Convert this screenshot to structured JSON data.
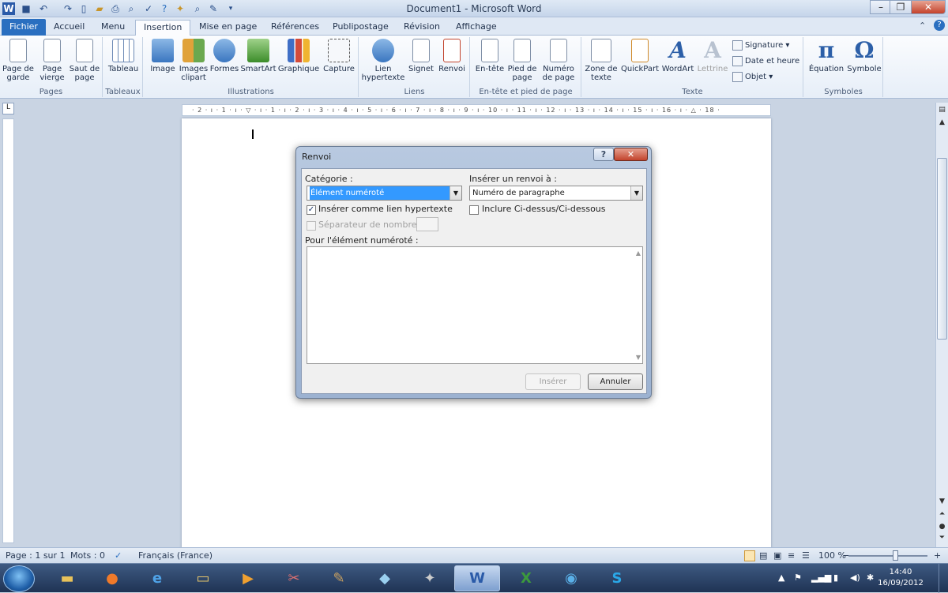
{
  "window": {
    "title": "Document1 - Microsoft Word"
  },
  "colors": {
    "accent": "#2a6fc0",
    "taskbar": "#1f3354",
    "close": "#c2432c"
  },
  "tabs": [
    "Fichier",
    "Accueil",
    "Menu",
    "Insertion",
    "Mise en page",
    "Références",
    "Publipostage",
    "Révision",
    "Affichage"
  ],
  "active_tab": "Insertion",
  "ribbon": {
    "groups": {
      "pages": "Pages",
      "tableaux": "Tableaux",
      "illustrations": "Illustrations",
      "liens": "Liens",
      "entete": "En-tête et pied de page",
      "texte": "Texte",
      "symboles": "Symboles"
    },
    "buttons": {
      "page_de_garde": "Page de garde",
      "page_vierge": "Page vierge",
      "saut_de_page": "Saut de page",
      "tableau": "Tableau",
      "image": "Image",
      "images_clipart": "Images clipart",
      "formes": "Formes",
      "smartart": "SmartArt",
      "graphique": "Graphique",
      "capture": "Capture",
      "lien_hypertexte": "Lien hypertexte",
      "signet": "Signet",
      "renvoi": "Renvoi",
      "en_tete": "En-tête",
      "pied_de_page": "Pied de page",
      "numero_de_page": "Numéro de page",
      "zone_de_texte": "Zone de texte",
      "quickpart": "QuickPart",
      "wordart": "WordArt",
      "lettrine": "Lettrine",
      "signature": "Signature",
      "date_et_heure": "Date et heure",
      "objet": "Objet",
      "equation": "Équation",
      "symbole": "Symbole"
    }
  },
  "ruler": {
    "numbers": "· 2 · ı · 1 · ı · ▽ · ı · 1 · ı · 2 · ı · 3 · ı · 4 · ı · 5 · ı · 6 · ı · 7 · ı · 8 · ı · 9 · ı · 10 · ı · 11 · ı · 12 · ı · 13 · ı · 14 · ı · 15 · ı · 16 · ı · △ · 18 ·"
  },
  "dialog": {
    "title": "Renvoi",
    "help": "?",
    "close": "✕",
    "categorie_label": "Catégorie :",
    "categorie_value": "Élément numéroté",
    "inserer_label": "Insérer un renvoi à :",
    "inserer_value": "Numéro de paragraphe",
    "chk_lien": "Insérer comme lien hypertexte",
    "chk_lien_checked": true,
    "chk_inclure": "Inclure Ci-dessus/Ci-dessous",
    "chk_inclure_checked": false,
    "chk_separateur": "Séparateur de nombres :",
    "pour_label": "Pour l'élément numéroté :",
    "btn_inserer": "Insérer",
    "btn_annuler": "Annuler"
  },
  "statusbar": {
    "page": "Page : 1 sur 1",
    "mots": "Mots : 0",
    "langue": "Français (France)",
    "zoom": "100 %",
    "zoom_level_percent": 100
  },
  "taskbar": {
    "time": "14:40",
    "date": "16/09/2012"
  }
}
